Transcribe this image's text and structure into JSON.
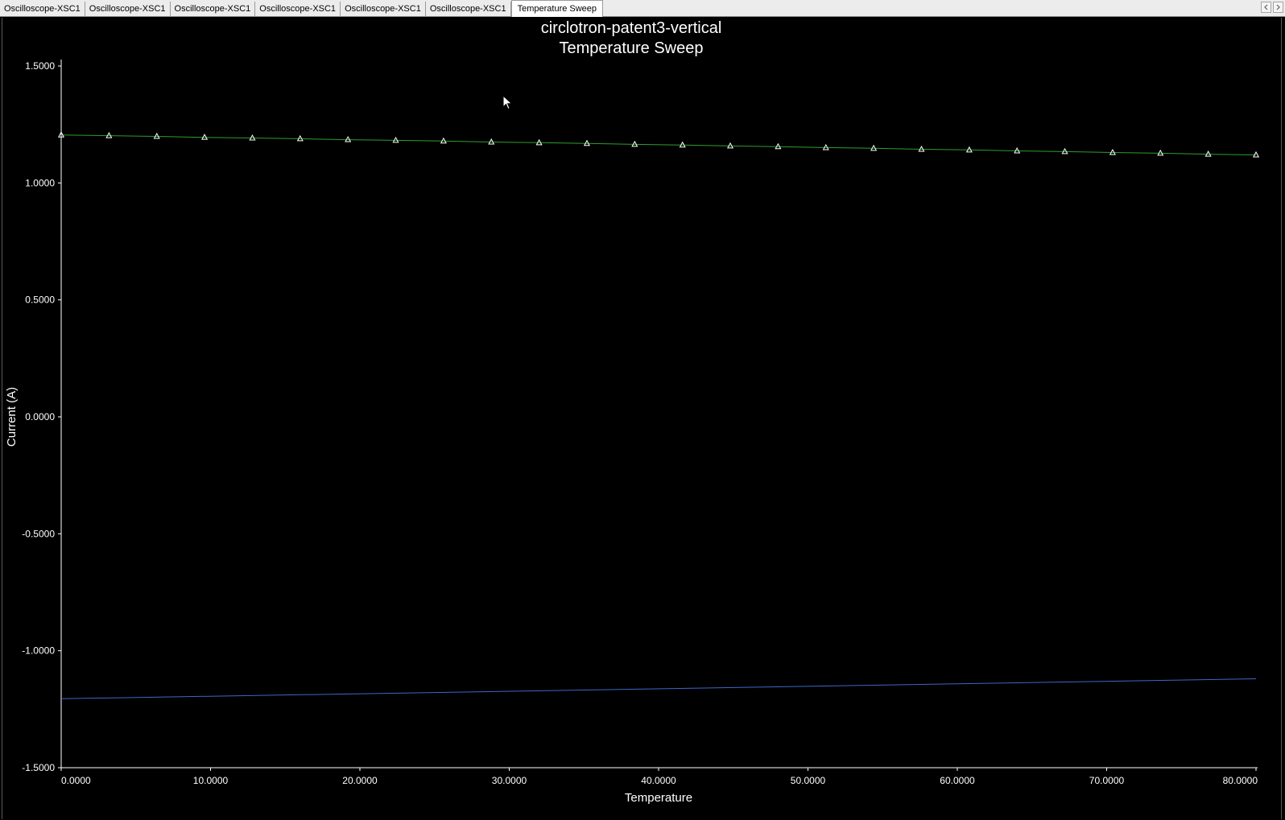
{
  "tabs": [
    {
      "label": "Oscilloscope-XSC1",
      "active": false
    },
    {
      "label": "Oscilloscope-XSC1",
      "active": false
    },
    {
      "label": "Oscilloscope-XSC1",
      "active": false
    },
    {
      "label": "Oscilloscope-XSC1",
      "active": false
    },
    {
      "label": "Oscilloscope-XSC1",
      "active": false
    },
    {
      "label": "Oscilloscope-XSC1",
      "active": false
    },
    {
      "label": "Temperature Sweep",
      "active": true
    }
  ],
  "scroll_buttons": {
    "left_icon": "chevron-left-icon",
    "right_icon": "chevron-right-icon"
  },
  "chart_data": {
    "type": "line",
    "title": "circlotron-patent3-vertical",
    "subtitle": "Temperature Sweep",
    "xlabel": "Temperature",
    "ylabel": "Current (A)",
    "xlim": [
      0,
      80
    ],
    "ylim": [
      -1.5,
      1.5
    ],
    "x_ticks": [
      0,
      10,
      20,
      30,
      40,
      50,
      60,
      70,
      80
    ],
    "x_tick_labels": [
      "0.0000",
      "10.0000",
      "20.0000",
      "30.0000",
      "40.0000",
      "50.0000",
      "60.0000",
      "70.0000",
      "80.0000"
    ],
    "y_ticks": [
      1.5,
      1.0,
      0.5,
      0.0,
      -0.5,
      -1.0,
      -1.5
    ],
    "y_tick_labels": [
      "1.5000",
      "1.0000",
      "0.5000",
      "0.0000",
      "-0.5000",
      "-1.0000",
      "-1.5000"
    ],
    "grid": false,
    "background": "#000000",
    "axis_color": "#ffffff",
    "series": [
      {
        "color": "#2e9e2e",
        "marker": "triangle",
        "marker_color": "#ffffff",
        "x": [
          0,
          3.2,
          6.4,
          9.6,
          12.8,
          16,
          19.2,
          22.4,
          25.6,
          28.8,
          32,
          35.2,
          38.4,
          41.6,
          44.8,
          48,
          51.2,
          54.4,
          57.6,
          60.8,
          64,
          67.2,
          70.4,
          73.6,
          76.8,
          80
        ],
        "y": [
          1.205,
          1.202,
          1.199,
          1.195,
          1.192,
          1.189,
          1.185,
          1.182,
          1.179,
          1.175,
          1.172,
          1.169,
          1.165,
          1.162,
          1.158,
          1.155,
          1.151,
          1.148,
          1.144,
          1.141,
          1.137,
          1.134,
          1.13,
          1.127,
          1.123,
          1.12
        ]
      },
      {
        "color": "#3f66c8",
        "marker": "none",
        "x": [
          0,
          80
        ],
        "y": [
          -1.205,
          -1.12
        ]
      }
    ]
  }
}
